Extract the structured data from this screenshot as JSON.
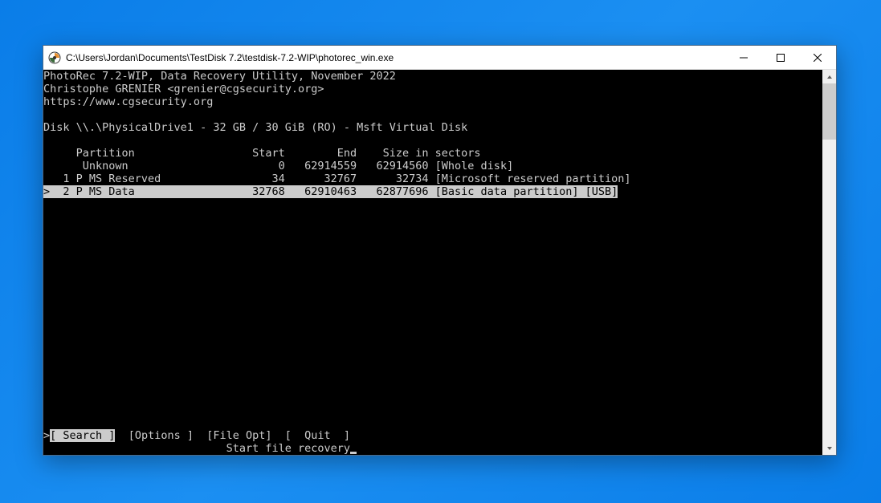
{
  "window": {
    "title": "C:\\Users\\Jordan\\Documents\\TestDisk 7.2\\testdisk-7.2-WIP\\photorec_win.exe"
  },
  "console": {
    "header1": "PhotoRec 7.2-WIP, Data Recovery Utility, November 2022",
    "header2": "Christophe GRENIER <grenier@cgsecurity.org>",
    "header3": "https://www.cgsecurity.org",
    "diskline": "Disk \\\\.\\PhysicalDrive1 - 32 GB / 30 GiB (RO) - Msft Virtual Disk",
    "table_header": "     Partition                  Start        End    Size in sectors",
    "rows": [
      {
        "text": "      Unknown                       0   62914559   62914560 [Whole disk]",
        "selected": false
      },
      {
        "text": "   1 P MS Reserved                 34      32767      32734 [Microsoft reserved partition]",
        "selected": false
      },
      {
        "text": ">  2 P MS Data                  32768   62910463   62877696 [Basic data partition] [USB]",
        "selected": true
      }
    ],
    "menu": {
      "prefix": ">",
      "search": "[ Search ]",
      "options": "[Options ]",
      "fileopt": "[File Opt]",
      "quit": "[  Quit  ]"
    },
    "hint_leading": "                            ",
    "hint": "Start file recovery"
  }
}
